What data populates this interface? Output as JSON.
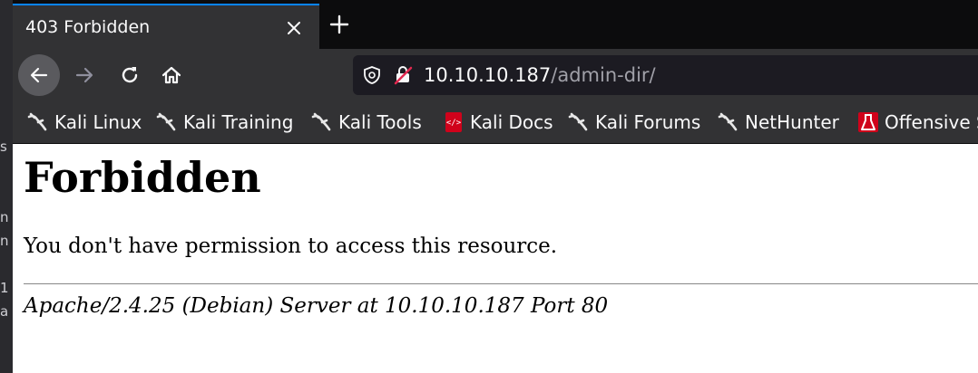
{
  "left_window": {
    "visible_chars": [
      "s",
      "n",
      "n",
      "1",
      "a"
    ]
  },
  "tab": {
    "title": "403 Forbidden",
    "close_icon": "close-icon",
    "new_tab_icon": "plus-icon"
  },
  "nav": {
    "back_icon": "arrow-left-icon",
    "forward_icon": "arrow-right-icon",
    "reload_icon": "reload-icon",
    "home_icon": "home-icon",
    "url_host": "10.10.10.187",
    "url_path": "/admin-dir/",
    "security_icons": [
      "shield-icon",
      "insecure-lock-icon"
    ]
  },
  "bookmarks": [
    {
      "label": "Kali Linux",
      "icon": "kali-dragon-icon"
    },
    {
      "label": "Kali Training",
      "icon": "kali-dragon-icon"
    },
    {
      "label": "Kali Tools",
      "icon": "kali-dragon-icon"
    },
    {
      "label": "Kali Docs",
      "icon": "kali-docs-icon"
    },
    {
      "label": "Kali Forums",
      "icon": "kali-dragon-icon"
    },
    {
      "label": "NetHunter",
      "icon": "kali-dragon-icon"
    },
    {
      "label": "Offensive S",
      "icon": "offensive-security-icon"
    }
  ],
  "page": {
    "heading": "Forbidden",
    "message": "You don't have permission to access this resource.",
    "server_signature": "Apache/2.4.25 (Debian) Server at 10.10.10.187 Port 80"
  },
  "colors": {
    "tab_accent": "#0a84ff",
    "toolbar_bg": "#323234",
    "tabstrip_bg": "#0c0c0d",
    "urlbar_bg": "#1c1b22",
    "docs_icon_red": "#d0021b"
  }
}
